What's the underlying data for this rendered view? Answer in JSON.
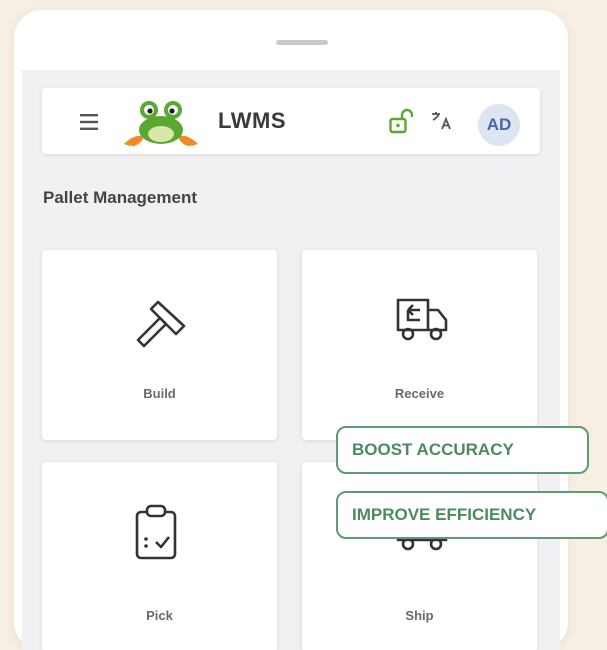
{
  "app": {
    "title": "LWMS",
    "avatar_initials": "AD",
    "menu_icon": "hamburger-menu-icon",
    "logo_icon": "frog-logo",
    "lock_icon": "unlocked-padlock-icon",
    "translate_icon": "translate-icon"
  },
  "page": {
    "section_title": "Pallet Management"
  },
  "tiles": [
    {
      "label": "Build",
      "icon": "hammer-icon"
    },
    {
      "label": "Receive",
      "icon": "truck-receive-icon"
    },
    {
      "label": "Pick",
      "icon": "clipboard-check-icon"
    },
    {
      "label": "Ship",
      "icon": "truck-ship-icon"
    }
  ],
  "callouts": {
    "accuracy": "BOOST ACCURACY",
    "efficiency": "IMPROVE EFFICIENCY"
  },
  "colors": {
    "background": "#f7efe3",
    "accent_green": "#5e9a72",
    "avatar_bg": "#dde5f3",
    "avatar_text": "#4a66a8"
  }
}
